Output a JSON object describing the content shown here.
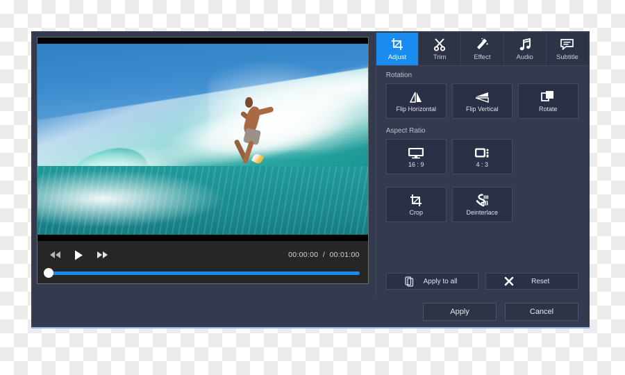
{
  "window": {
    "accent_color": "#1a8cf0",
    "panel_color": "#343b4f",
    "button_color": "#2a3147"
  },
  "player": {
    "video_description": "surfer riding a large turquoise ocean wave under blue sky",
    "transport": {
      "rewind_label": "Rewind",
      "play_label": "Play",
      "forward_label": "Fast Forward"
    },
    "current_time": "00:00:00",
    "time_separator": "/",
    "total_time": "00:01:00",
    "time_display": "00:00:00  /  00:01:00",
    "progress_percent": 0
  },
  "tabs": [
    {
      "label": "Adjust",
      "icon": "crop-icon",
      "active": true
    },
    {
      "label": "Trim",
      "icon": "scissors-icon",
      "active": false
    },
    {
      "label": "Effect",
      "icon": "magic-wand-icon",
      "active": false
    },
    {
      "label": "Audio",
      "icon": "music-note-icon",
      "active": false
    },
    {
      "label": "Subtitle",
      "icon": "speech-bubble-icon",
      "active": false
    }
  ],
  "adjust": {
    "rotation": {
      "label": "Rotation",
      "buttons": [
        {
          "label": "Flip Horizontal",
          "icon": "flip-horizontal-icon"
        },
        {
          "label": "Flip Vertical",
          "icon": "flip-vertical-icon"
        },
        {
          "label": "Rotate",
          "icon": "rotate-icon"
        }
      ]
    },
    "aspect_ratio": {
      "label": "Aspect Ratio",
      "buttons": [
        {
          "label": "16 : 9",
          "icon": "monitor-icon"
        },
        {
          "label": "4 : 3",
          "icon": "tv-icon"
        }
      ]
    },
    "extra": {
      "buttons": [
        {
          "label": "Crop",
          "icon": "crop-icon"
        },
        {
          "label": "Deinterlace",
          "icon": "deinterlace-icon"
        }
      ]
    },
    "actions": [
      {
        "label": "Apply to all",
        "icon": "copy-icon"
      },
      {
        "label": "Reset",
        "icon": "close-x-icon"
      }
    ]
  },
  "footer": {
    "apply_label": "Apply",
    "cancel_label": "Cancel"
  }
}
